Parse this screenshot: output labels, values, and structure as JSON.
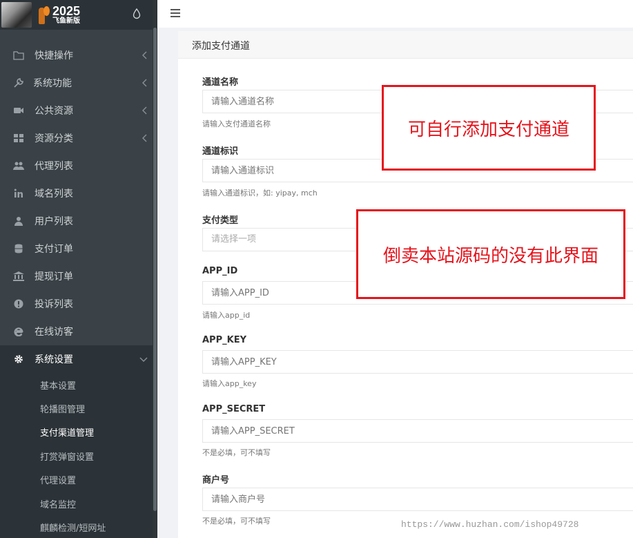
{
  "logo": {
    "year": "2025",
    "subtitle": "飞鱼新版"
  },
  "menu": [
    {
      "label": "快捷操作",
      "icon": "folder-icon",
      "has_arrow": true
    },
    {
      "label": "系统功能",
      "icon": "wrench-icon",
      "has_arrow": true
    },
    {
      "label": "公共资源",
      "icon": "video-camera-icon",
      "has_arrow": true
    },
    {
      "label": "资源分类",
      "icon": "grid-icon",
      "has_arrow": true
    },
    {
      "label": "代理列表",
      "icon": "users-icon",
      "has_arrow": false
    },
    {
      "label": "域名列表",
      "icon": "linkedin-icon",
      "has_arrow": false
    },
    {
      "label": "用户列表",
      "icon": "user-icon",
      "has_arrow": false
    },
    {
      "label": "支付订单",
      "icon": "database-icon",
      "has_arrow": false
    },
    {
      "label": "提现订单",
      "icon": "bank-icon",
      "has_arrow": false
    },
    {
      "label": "投诉列表",
      "icon": "exclamation-icon",
      "has_arrow": false
    },
    {
      "label": "在线访客",
      "icon": "browser-e-icon",
      "has_arrow": false
    },
    {
      "label": "系统设置",
      "icon": "gear-icon",
      "has_arrow": true
    }
  ],
  "submenu": [
    {
      "label": "基本设置"
    },
    {
      "label": "轮播图管理"
    },
    {
      "label": "支付渠道管理"
    },
    {
      "label": "打赏弹窗设置"
    },
    {
      "label": "代理设置"
    },
    {
      "label": "域名监控"
    },
    {
      "label": "麒麟检测/短网址"
    }
  ],
  "active_submenu_index": 2,
  "panel": {
    "title": "添加支付通道"
  },
  "form": {
    "channel_name": {
      "label": "通道名称",
      "placeholder": "请输入通道名称",
      "help": "请输入支付通道名称"
    },
    "channel_id": {
      "label": "通道标识",
      "placeholder": "请输入通道标识",
      "help": "请输入通道标识，如: yipay, mch"
    },
    "pay_type": {
      "label": "支付类型",
      "placeholder": "请选择一项"
    },
    "app_id": {
      "label": "APP_ID",
      "placeholder": "请输入APP_ID",
      "help": "请输入app_id"
    },
    "app_key": {
      "label": "APP_KEY",
      "placeholder": "请输入APP_KEY",
      "help": "请输入app_key"
    },
    "app_secret": {
      "label": "APP_SECRET",
      "placeholder": "请输入APP_SECRET",
      "help": "不是必填，可不填写"
    },
    "merchant_no": {
      "label": "商户号",
      "placeholder": "请输入商户号",
      "help": "不是必填，可不填写"
    }
  },
  "callouts": {
    "first": "可自行添加支付通道",
    "second": "倒卖本站源码的没有此界面",
    "border_color": "#e5141c"
  },
  "watermark": "https://www.huzhan.com/ishop49728",
  "colors": {
    "sidebar_bg": "#3a4247",
    "sidebar_dark": "#2c3338",
    "accent_red": "#e5141c"
  }
}
